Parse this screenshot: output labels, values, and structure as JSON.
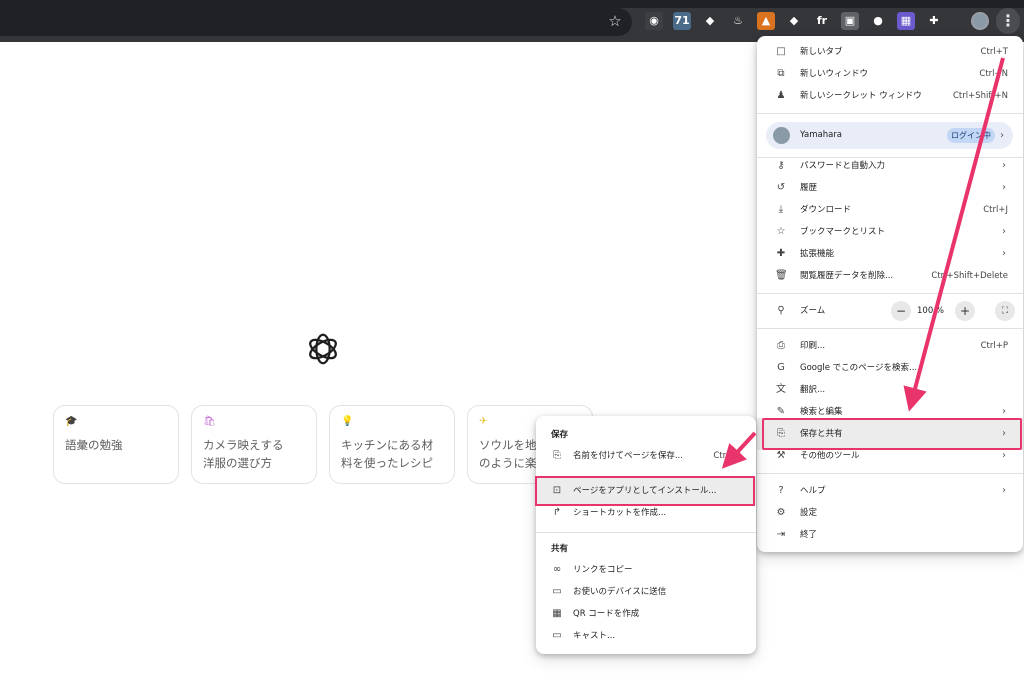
{
  "toolbar": {
    "extensions": [
      {
        "name": "camera-extension-icon",
        "glyph": "◉",
        "bg": "#3c4043"
      },
      {
        "name": "seventy-one-extension-icon",
        "glyph": "71",
        "bg": "#4a6b8a"
      },
      {
        "name": "color-wheel-extension-icon",
        "glyph": "◆",
        "bg": "#35363a"
      },
      {
        "name": "bulb-extension-icon",
        "glyph": "♨",
        "bg": "#35363a"
      },
      {
        "name": "fox-extension-icon",
        "glyph": "▲",
        "bg": "#d9731f"
      },
      {
        "name": "gem-extension-icon",
        "glyph": "◆",
        "bg": "#35363a"
      },
      {
        "name": "ft-extension-icon",
        "glyph": "fr",
        "bg": "#35363a"
      },
      {
        "name": "image-extension-icon",
        "glyph": "▣",
        "bg": "#5f6368"
      },
      {
        "name": "mic-extension-icon",
        "glyph": "●",
        "bg": "#35363a"
      },
      {
        "name": "purple-extension-icon",
        "glyph": "▦",
        "bg": "#6a5acd"
      },
      {
        "name": "puzzle-extension-icon",
        "glyph": "✚",
        "bg": "#35363a"
      }
    ]
  },
  "suggestions": [
    {
      "text": "語彙の勉強",
      "color": "#4fc3d9"
    },
    {
      "text": "カメラ映えする\n洋服の選び方",
      "color": "#c46fd8"
    },
    {
      "text": "キッチンにある材\n料を使ったレシピ",
      "color": "#e8c53a"
    },
    {
      "text": "ソウルを地元\nのように楽しむ",
      "color": "#e8c53a"
    }
  ],
  "main_menu": {
    "group1": [
      {
        "icon": "□",
        "label": "新しいタブ",
        "shortcut": "Ctrl+T"
      },
      {
        "icon": "⧉",
        "label": "新しいウィンドウ",
        "shortcut": "Ctrl+N"
      },
      {
        "icon": "♟",
        "label": "新しいシークレット ウィンドウ",
        "shortcut": "Ctrl+Shift+N"
      }
    ],
    "profile": {
      "name": "Yamahara",
      "badge": "ログイン中"
    },
    "group2": [
      {
        "icon": "⚷",
        "label": "パスワードと自動入力",
        "shortcut": "",
        "chevron": true
      },
      {
        "icon": "↺",
        "label": "履歴",
        "shortcut": "",
        "chevron": true
      },
      {
        "icon": "⤓",
        "label": "ダウンロード",
        "shortcut": "Ctrl+J",
        "chevron": false
      },
      {
        "icon": "☆",
        "label": "ブックマークとリスト",
        "shortcut": "",
        "chevron": true
      },
      {
        "icon": "✚",
        "label": "拡張機能",
        "shortcut": "",
        "chevron": true
      },
      {
        "icon": "🗑",
        "label": "閲覧履歴データを削除...",
        "shortcut": "Ctrl+Shift+Delete",
        "chevron": false
      }
    ],
    "zoom": {
      "label": "ズーム",
      "value": "100 %",
      "minus": "−",
      "plus": "+",
      "fullscreen": "⛶"
    },
    "group3": [
      {
        "icon": "⎙",
        "label": "印刷...",
        "shortcut": "Ctrl+P",
        "chevron": false
      },
      {
        "icon": "G",
        "label": "Google でこのページを検索...",
        "shortcut": "",
        "chevron": false
      },
      {
        "icon": "文",
        "label": "翻訳...",
        "shortcut": "",
        "chevron": false
      },
      {
        "icon": "✎",
        "label": "検索と編集",
        "shortcut": "",
        "chevron": true
      },
      {
        "icon": "⎘",
        "label": "保存と共有",
        "shortcut": "",
        "chevron": true
      },
      {
        "icon": "⚒",
        "label": "その他のツール",
        "shortcut": "",
        "chevron": true
      }
    ],
    "group4": [
      {
        "icon": "?",
        "label": "ヘルプ",
        "shortcut": "",
        "chevron": true
      },
      {
        "icon": "⚙",
        "label": "設定",
        "shortcut": "",
        "chevron": false
      },
      {
        "icon": "⇥",
        "label": "終了",
        "shortcut": "",
        "chevron": false
      }
    ]
  },
  "sub_menu": {
    "save_title": "保存",
    "save_items": [
      {
        "icon": "⎘",
        "label": "名前を付けてページを保存...",
        "shortcut": "Ctrl+S"
      },
      {
        "icon": "⊡",
        "label": "ページをアプリとしてインストール...",
        "shortcut": ""
      },
      {
        "icon": "↱",
        "label": "ショートカットを作成...",
        "shortcut": ""
      }
    ],
    "share_title": "共有",
    "share_items": [
      {
        "icon": "∞",
        "label": "リンクをコピー"
      },
      {
        "icon": "▭",
        "label": "お使いのデバイスに送信"
      },
      {
        "icon": "▦",
        "label": "QR コードを作成"
      },
      {
        "icon": "▭",
        "label": "キャスト..."
      }
    ]
  },
  "highlight_color": "#e8336b"
}
